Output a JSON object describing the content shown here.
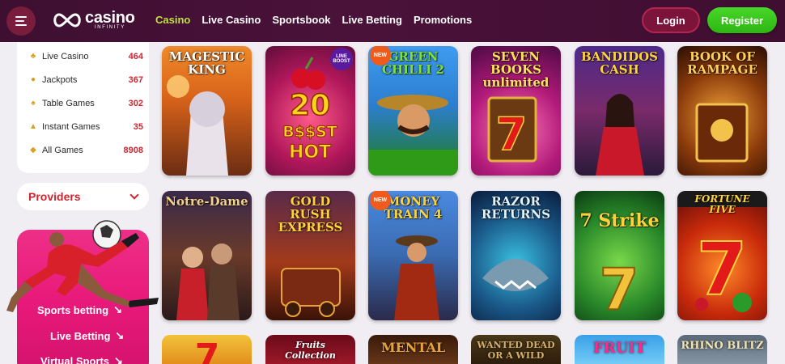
{
  "header": {
    "logo_main": "casino",
    "logo_sub": "INFINITY",
    "nav": [
      {
        "label": "Casino",
        "active": true
      },
      {
        "label": "Live Casino",
        "active": false
      },
      {
        "label": "Sportsbook",
        "active": false
      },
      {
        "label": "Live Betting",
        "active": false
      },
      {
        "label": "Promotions",
        "active": false
      }
    ],
    "login_label": "Login",
    "register_label": "Register"
  },
  "sidebar": {
    "categories": [
      {
        "label": "Live Casino",
        "count": "464",
        "icon": "live-casino-icon"
      },
      {
        "label": "Jackpots",
        "count": "367",
        "icon": "jackpot-icon"
      },
      {
        "label": "Table Games",
        "count": "302",
        "icon": "table-games-icon"
      },
      {
        "label": "Instant Games",
        "count": "35",
        "icon": "instant-games-icon"
      },
      {
        "label": "All Games",
        "count": "8908",
        "icon": "all-games-icon"
      }
    ],
    "providers_label": "Providers",
    "promo_links": [
      {
        "label": "Sports betting",
        "arrow": "↘"
      },
      {
        "label": "Live Betting",
        "arrow": "↘"
      },
      {
        "label": "Virtual Sports",
        "arrow": "↘"
      }
    ]
  },
  "games": [
    {
      "title": "MAGESTIC KING",
      "badge": ""
    },
    {
      "title": "20 B$$ST HOT",
      "badge": "LINE BOOST"
    },
    {
      "title": "GREEN CHILLI 2",
      "badge": "NEW"
    },
    {
      "title": "SEVEN BOOKS unlimited",
      "badge": ""
    },
    {
      "title": "BANDIDOS CASH",
      "badge": ""
    },
    {
      "title": "BOOK OF RAMPAGE",
      "badge": ""
    },
    {
      "title": "Notre-Dame",
      "badge": ""
    },
    {
      "title": "GOLD RUSH EXPRESS",
      "badge": ""
    },
    {
      "title": "MONEY TRAIN 4",
      "badge": "NEW"
    },
    {
      "title": "RAZOR RETURNS",
      "badge": ""
    },
    {
      "title": "7 Strike",
      "badge": ""
    },
    {
      "title": "FORTUNE FIVE",
      "badge": ""
    }
  ],
  "games_bottom_row": [
    {
      "title": ""
    },
    {
      "title": "Fruits Collection"
    },
    {
      "title": "MENTAL"
    },
    {
      "title": "WANTED DEAD OR A WILD"
    },
    {
      "title": "FRUIT"
    },
    {
      "title": "RHINO BLITZ"
    }
  ],
  "colors": {
    "header_bg": "#4a1239",
    "active_nav": "#bfe23c",
    "login_bg": "#7b1438",
    "register_bg": "#2eb512",
    "count_red": "#d0252f",
    "promo_pink": "#e8197a"
  }
}
